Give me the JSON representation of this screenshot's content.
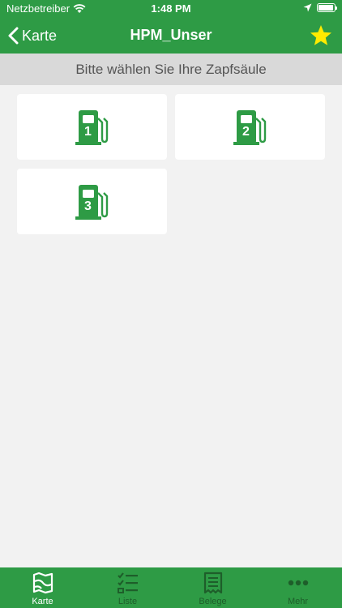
{
  "status_bar": {
    "carrier": "Netzbetreiber",
    "time": "1:48 PM"
  },
  "nav": {
    "back_label": "Karte",
    "title": "HPM_Unser"
  },
  "sub_header": {
    "text": "Bitte wählen Sie Ihre Zapfsäule"
  },
  "pumps": [
    {
      "number": "1"
    },
    {
      "number": "2"
    },
    {
      "number": "3"
    }
  ],
  "tabs": [
    {
      "label": "Karte",
      "icon": "map-icon",
      "active": true
    },
    {
      "label": "Liste",
      "icon": "list-icon",
      "active": false
    },
    {
      "label": "Belege",
      "icon": "receipt-icon",
      "active": false
    },
    {
      "label": "Mehr",
      "icon": "more-icon",
      "active": false
    }
  ],
  "colors": {
    "brand_green": "#2e9b45",
    "tab_inactive": "#1e5e2a",
    "star": "#ffeb00"
  }
}
